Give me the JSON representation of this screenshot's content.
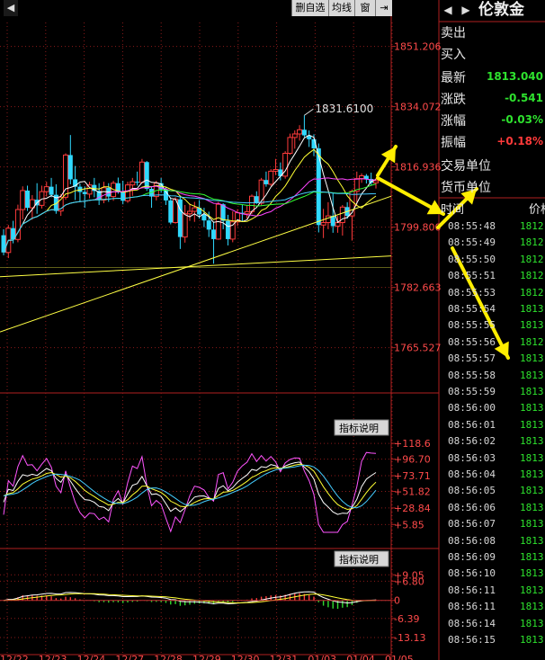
{
  "toolbar": {
    "delete_watch": "删自选",
    "ma_label": "均线",
    "window_label": "窗"
  },
  "side": {
    "title": "伦敦金",
    "rows": [
      {
        "label": "卖出",
        "value": ""
      },
      {
        "label": "买入",
        "value": ""
      },
      {
        "label": "最新",
        "value": "1813.040"
      },
      {
        "label": "涨跌",
        "value": "-0.541"
      },
      {
        "label": "涨幅",
        "value": "-0.03%"
      },
      {
        "label": "振幅",
        "value": "+0.18%"
      },
      {
        "label": "交易单位",
        "value": ""
      },
      {
        "label": "货币单位",
        "value": ""
      }
    ],
    "tick_header_time": "时间",
    "tick_header_price": "价格",
    "ticks": [
      {
        "t": "08:55:48",
        "p": "1812."
      },
      {
        "t": "08:55:49",
        "p": "1812."
      },
      {
        "t": "08:55:50",
        "p": "1812."
      },
      {
        "t": "08:55:51",
        "p": "1812."
      },
      {
        "t": "08:55:53",
        "p": "1812."
      },
      {
        "t": "08:55:54",
        "p": "1813."
      },
      {
        "t": "08:55:55",
        "p": "1813."
      },
      {
        "t": "08:55:56",
        "p": "1812."
      },
      {
        "t": "08:55:57",
        "p": "1813."
      },
      {
        "t": "08:55:58",
        "p": "1813."
      },
      {
        "t": "08:55:59",
        "p": "1813."
      },
      {
        "t": "08:56:00",
        "p": "1813."
      },
      {
        "t": "08:56:01",
        "p": "1813."
      },
      {
        "t": "08:56:02",
        "p": "1813."
      },
      {
        "t": "08:56:03",
        "p": "1813."
      },
      {
        "t": "08:56:04",
        "p": "1813."
      },
      {
        "t": "08:56:05",
        "p": "1813."
      },
      {
        "t": "08:56:06",
        "p": "1813."
      },
      {
        "t": "08:56:07",
        "p": "1813."
      },
      {
        "t": "08:56:08",
        "p": "1813."
      },
      {
        "t": "08:56:09",
        "p": "1813."
      },
      {
        "t": "08:56:10",
        "p": "1813."
      },
      {
        "t": "08:56:11",
        "p": "1813."
      },
      {
        "t": "08:56:11",
        "p": "1813."
      },
      {
        "t": "08:56:14",
        "p": "1813."
      },
      {
        "t": "08:56:15",
        "p": "1813."
      }
    ]
  },
  "chart_data": {
    "type": "candlestick",
    "price_axis": {
      "ticks": [
        "1851.206",
        "1834.072",
        "1816.936",
        "1799.800",
        "1782.663",
        "1765.527"
      ],
      "range": [
        1757.0,
        1858.0
      ]
    },
    "max_label": "1831.6100",
    "indicator_label": "指标说明",
    "kdj_axis": {
      "ticks": [
        "+118.6",
        "+96.70",
        "+73.71",
        "+51.82",
        "+28.84",
        "+5.85"
      ],
      "range": [
        -5,
        125
      ]
    },
    "macd_axis": {
      "ticks": [
        "+9.05",
        "+6.80",
        "0",
        "-6.39",
        "-13.13"
      ],
      "range": [
        -16,
        12
      ]
    },
    "x_ticks": [
      "12/22",
      "12/23",
      "12/24",
      "12/27",
      "12/28",
      "12/29",
      "12/30",
      "12/31",
      "01/03",
      "01/04",
      "01/05"
    ],
    "candles": [
      [
        1797.5,
        1799.2,
        1791.8,
        1792.6
      ],
      [
        1792.6,
        1800.4,
        1791.0,
        1799.5
      ],
      [
        1799.5,
        1801.6,
        1795.2,
        1796.3
      ],
      [
        1796.3,
        1806.2,
        1795.5,
        1804.8
      ],
      [
        1804.8,
        1811.4,
        1802.0,
        1810.2
      ],
      [
        1810.2,
        1811.6,
        1804.4,
        1805.3
      ],
      [
        1805.3,
        1808.9,
        1801.9,
        1807.6
      ],
      [
        1807.6,
        1812.3,
        1803.6,
        1806.0
      ],
      [
        1806.0,
        1811.6,
        1805.1,
        1809.9
      ],
      [
        1809.9,
        1812.7,
        1808.5,
        1811.3
      ],
      [
        1811.3,
        1813.8,
        1808.3,
        1809.0
      ],
      [
        1809.0,
        1812.0,
        1803.6,
        1804.4
      ],
      [
        1804.4,
        1809.2,
        1803.0,
        1808.3
      ],
      [
        1808.3,
        1820.8,
        1807.6,
        1820.3
      ],
      [
        1820.3,
        1826.0,
        1812.0,
        1813.4
      ],
      [
        1813.4,
        1817.2,
        1807.5,
        1811.3
      ],
      [
        1811.3,
        1812.2,
        1807.2,
        1809.8
      ],
      [
        1809.8,
        1811.4,
        1805.3,
        1809.2
      ],
      [
        1809.2,
        1812.7,
        1808.0,
        1811.8
      ],
      [
        1811.8,
        1813.8,
        1808.3,
        1810.1
      ],
      [
        1810.1,
        1812.3,
        1806.1,
        1807.5
      ],
      [
        1807.5,
        1812.7,
        1806.6,
        1811.0
      ],
      [
        1811.0,
        1812.3,
        1807.0,
        1808.5
      ],
      [
        1808.5,
        1813.0,
        1807.3,
        1812.3
      ],
      [
        1812.3,
        1813.9,
        1809.3,
        1809.9
      ],
      [
        1809.9,
        1813.0,
        1806.3,
        1807.3
      ],
      [
        1807.3,
        1812.7,
        1806.7,
        1811.8
      ],
      [
        1811.8,
        1813.8,
        1808.7,
        1812.7
      ],
      [
        1812.7,
        1815.6,
        1811.6,
        1812.5
      ],
      [
        1812.5,
        1819.2,
        1812.3,
        1818.3
      ],
      [
        1818.3,
        1818.6,
        1810.1,
        1810.7
      ],
      [
        1810.7,
        1811.4,
        1805.3,
        1808.5
      ],
      [
        1808.5,
        1813.0,
        1807.4,
        1812.3
      ],
      [
        1812.3,
        1813.8,
        1809.6,
        1810.5
      ],
      [
        1810.5,
        1811.2,
        1806.1,
        1807.4
      ],
      [
        1807.4,
        1808.2,
        1800.6,
        1801.1
      ],
      [
        1801.1,
        1808.3,
        1800.8,
        1807.7
      ],
      [
        1807.7,
        1808.8,
        1793.6,
        1797.0
      ],
      [
        1797.0,
        1806.1,
        1795.4,
        1803.6
      ],
      [
        1803.6,
        1806.5,
        1801.6,
        1804.3
      ],
      [
        1804.3,
        1807.0,
        1801.3,
        1805.3
      ],
      [
        1805.3,
        1807.5,
        1802.2,
        1803.4
      ],
      [
        1803.4,
        1805.3,
        1799.8,
        1801.7
      ],
      [
        1801.7,
        1804.2,
        1797.0,
        1799.1
      ],
      [
        1799.1,
        1801.2,
        1789.4,
        1796.4
      ],
      [
        1796.4,
        1807.0,
        1796.2,
        1806.3
      ],
      [
        1806.3,
        1806.6,
        1799.2,
        1801.6
      ],
      [
        1801.6,
        1803.3,
        1794.6,
        1796.4
      ],
      [
        1796.4,
        1804.3,
        1795.5,
        1801.3
      ],
      [
        1801.3,
        1804.9,
        1800.1,
        1803.9
      ],
      [
        1803.9,
        1806.1,
        1801.5,
        1803.6
      ],
      [
        1803.6,
        1806.1,
        1802.2,
        1804.2
      ],
      [
        1804.2,
        1809.1,
        1803.5,
        1808.6
      ],
      [
        1808.6,
        1810.0,
        1806.4,
        1806.6
      ],
      [
        1806.6,
        1813.8,
        1806.0,
        1813.2
      ],
      [
        1813.2,
        1815.6,
        1811.3,
        1812.0
      ],
      [
        1812.0,
        1816.3,
        1811.5,
        1815.7
      ],
      [
        1815.7,
        1819.2,
        1814.6,
        1816.2
      ],
      [
        1816.2,
        1818.2,
        1813.1,
        1814.3
      ],
      [
        1814.3,
        1821.4,
        1813.6,
        1820.8
      ],
      [
        1820.8,
        1826.4,
        1820.4,
        1825.3
      ],
      [
        1825.3,
        1827.3,
        1822.1,
        1826.3
      ],
      [
        1826.3,
        1828.8,
        1824.4,
        1827.5
      ],
      [
        1827.5,
        1831.6,
        1825.4,
        1825.9
      ],
      [
        1825.9,
        1827.3,
        1822.6,
        1824.8
      ],
      [
        1824.8,
        1826.2,
        1820.0,
        1822.2
      ],
      [
        1822.2,
        1823.6,
        1798.3,
        1800.4
      ],
      [
        1800.4,
        1805.0,
        1796.7,
        1801.1
      ],
      [
        1801.1,
        1806.9,
        1799.2,
        1803.0
      ],
      [
        1803.0,
        1809.4,
        1798.2,
        1800.1
      ],
      [
        1800.1,
        1803.0,
        1798.2,
        1801.1
      ],
      [
        1801.1,
        1806.1,
        1797.4,
        1805.5
      ],
      [
        1805.5,
        1806.9,
        1802.2,
        1803.0
      ],
      [
        1803.0,
        1810.5,
        1796.0,
        1810.0
      ],
      [
        1810.0,
        1815.6,
        1805.8,
        1813.6
      ],
      [
        1813.6,
        1815.1,
        1812.4,
        1814.4
      ],
      [
        1814.4,
        1814.9,
        1812.2,
        1813.5
      ],
      [
        1813.5,
        1815.3,
        1811.7,
        1812.4
      ],
      [
        1812.4,
        1813.8,
        1810.8,
        1813.0
      ]
    ]
  }
}
